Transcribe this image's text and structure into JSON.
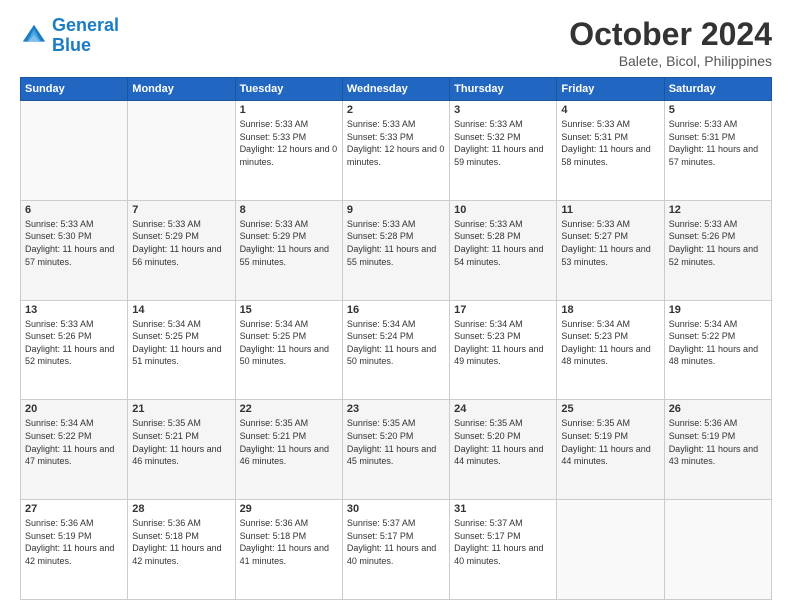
{
  "logo": {
    "line1": "General",
    "line2": "Blue"
  },
  "title": "October 2024",
  "subtitle": "Balete, Bicol, Philippines",
  "weekdays": [
    "Sunday",
    "Monday",
    "Tuesday",
    "Wednesday",
    "Thursday",
    "Friday",
    "Saturday"
  ],
  "weeks": [
    [
      {
        "day": "",
        "sunrise": "",
        "sunset": "",
        "daylight": ""
      },
      {
        "day": "",
        "sunrise": "",
        "sunset": "",
        "daylight": ""
      },
      {
        "day": "1",
        "sunrise": "Sunrise: 5:33 AM",
        "sunset": "Sunset: 5:33 PM",
        "daylight": "Daylight: 12 hours and 0 minutes."
      },
      {
        "day": "2",
        "sunrise": "Sunrise: 5:33 AM",
        "sunset": "Sunset: 5:33 PM",
        "daylight": "Daylight: 12 hours and 0 minutes."
      },
      {
        "day": "3",
        "sunrise": "Sunrise: 5:33 AM",
        "sunset": "Sunset: 5:32 PM",
        "daylight": "Daylight: 11 hours and 59 minutes."
      },
      {
        "day": "4",
        "sunrise": "Sunrise: 5:33 AM",
        "sunset": "Sunset: 5:31 PM",
        "daylight": "Daylight: 11 hours and 58 minutes."
      },
      {
        "day": "5",
        "sunrise": "Sunrise: 5:33 AM",
        "sunset": "Sunset: 5:31 PM",
        "daylight": "Daylight: 11 hours and 57 minutes."
      }
    ],
    [
      {
        "day": "6",
        "sunrise": "Sunrise: 5:33 AM",
        "sunset": "Sunset: 5:30 PM",
        "daylight": "Daylight: 11 hours and 57 minutes."
      },
      {
        "day": "7",
        "sunrise": "Sunrise: 5:33 AM",
        "sunset": "Sunset: 5:29 PM",
        "daylight": "Daylight: 11 hours and 56 minutes."
      },
      {
        "day": "8",
        "sunrise": "Sunrise: 5:33 AM",
        "sunset": "Sunset: 5:29 PM",
        "daylight": "Daylight: 11 hours and 55 minutes."
      },
      {
        "day": "9",
        "sunrise": "Sunrise: 5:33 AM",
        "sunset": "Sunset: 5:28 PM",
        "daylight": "Daylight: 11 hours and 55 minutes."
      },
      {
        "day": "10",
        "sunrise": "Sunrise: 5:33 AM",
        "sunset": "Sunset: 5:28 PM",
        "daylight": "Daylight: 11 hours and 54 minutes."
      },
      {
        "day": "11",
        "sunrise": "Sunrise: 5:33 AM",
        "sunset": "Sunset: 5:27 PM",
        "daylight": "Daylight: 11 hours and 53 minutes."
      },
      {
        "day": "12",
        "sunrise": "Sunrise: 5:33 AM",
        "sunset": "Sunset: 5:26 PM",
        "daylight": "Daylight: 11 hours and 52 minutes."
      }
    ],
    [
      {
        "day": "13",
        "sunrise": "Sunrise: 5:33 AM",
        "sunset": "Sunset: 5:26 PM",
        "daylight": "Daylight: 11 hours and 52 minutes."
      },
      {
        "day": "14",
        "sunrise": "Sunrise: 5:34 AM",
        "sunset": "Sunset: 5:25 PM",
        "daylight": "Daylight: 11 hours and 51 minutes."
      },
      {
        "day": "15",
        "sunrise": "Sunrise: 5:34 AM",
        "sunset": "Sunset: 5:25 PM",
        "daylight": "Daylight: 11 hours and 50 minutes."
      },
      {
        "day": "16",
        "sunrise": "Sunrise: 5:34 AM",
        "sunset": "Sunset: 5:24 PM",
        "daylight": "Daylight: 11 hours and 50 minutes."
      },
      {
        "day": "17",
        "sunrise": "Sunrise: 5:34 AM",
        "sunset": "Sunset: 5:23 PM",
        "daylight": "Daylight: 11 hours and 49 minutes."
      },
      {
        "day": "18",
        "sunrise": "Sunrise: 5:34 AM",
        "sunset": "Sunset: 5:23 PM",
        "daylight": "Daylight: 11 hours and 48 minutes."
      },
      {
        "day": "19",
        "sunrise": "Sunrise: 5:34 AM",
        "sunset": "Sunset: 5:22 PM",
        "daylight": "Daylight: 11 hours and 48 minutes."
      }
    ],
    [
      {
        "day": "20",
        "sunrise": "Sunrise: 5:34 AM",
        "sunset": "Sunset: 5:22 PM",
        "daylight": "Daylight: 11 hours and 47 minutes."
      },
      {
        "day": "21",
        "sunrise": "Sunrise: 5:35 AM",
        "sunset": "Sunset: 5:21 PM",
        "daylight": "Daylight: 11 hours and 46 minutes."
      },
      {
        "day": "22",
        "sunrise": "Sunrise: 5:35 AM",
        "sunset": "Sunset: 5:21 PM",
        "daylight": "Daylight: 11 hours and 46 minutes."
      },
      {
        "day": "23",
        "sunrise": "Sunrise: 5:35 AM",
        "sunset": "Sunset: 5:20 PM",
        "daylight": "Daylight: 11 hours and 45 minutes."
      },
      {
        "day": "24",
        "sunrise": "Sunrise: 5:35 AM",
        "sunset": "Sunset: 5:20 PM",
        "daylight": "Daylight: 11 hours and 44 minutes."
      },
      {
        "day": "25",
        "sunrise": "Sunrise: 5:35 AM",
        "sunset": "Sunset: 5:19 PM",
        "daylight": "Daylight: 11 hours and 44 minutes."
      },
      {
        "day": "26",
        "sunrise": "Sunrise: 5:36 AM",
        "sunset": "Sunset: 5:19 PM",
        "daylight": "Daylight: 11 hours and 43 minutes."
      }
    ],
    [
      {
        "day": "27",
        "sunrise": "Sunrise: 5:36 AM",
        "sunset": "Sunset: 5:19 PM",
        "daylight": "Daylight: 11 hours and 42 minutes."
      },
      {
        "day": "28",
        "sunrise": "Sunrise: 5:36 AM",
        "sunset": "Sunset: 5:18 PM",
        "daylight": "Daylight: 11 hours and 42 minutes."
      },
      {
        "day": "29",
        "sunrise": "Sunrise: 5:36 AM",
        "sunset": "Sunset: 5:18 PM",
        "daylight": "Daylight: 11 hours and 41 minutes."
      },
      {
        "day": "30",
        "sunrise": "Sunrise: 5:37 AM",
        "sunset": "Sunset: 5:17 PM",
        "daylight": "Daylight: 11 hours and 40 minutes."
      },
      {
        "day": "31",
        "sunrise": "Sunrise: 5:37 AM",
        "sunset": "Sunset: 5:17 PM",
        "daylight": "Daylight: 11 hours and 40 minutes."
      },
      {
        "day": "",
        "sunrise": "",
        "sunset": "",
        "daylight": ""
      },
      {
        "day": "",
        "sunrise": "",
        "sunset": "",
        "daylight": ""
      }
    ]
  ]
}
